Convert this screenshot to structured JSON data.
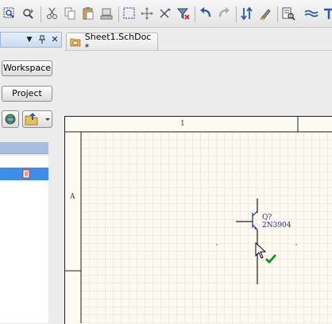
{
  "toolbar": {
    "icons": [
      "zoom-fit-icon",
      "zoom-area-icon",
      "cut-icon",
      "copy-icon",
      "paste-icon",
      "rubber-stamp-icon",
      "select-area-icon",
      "move-icon",
      "cross-select-icon",
      "clear-filter-icon",
      "undo-icon",
      "redo-icon",
      "net-color-icon",
      "highlight-icon",
      "inspector-icon",
      "bus-icon",
      "parameter-icon"
    ]
  },
  "panel": {
    "menu_glyph": "▼",
    "pin_glyph": "📌",
    "close_glyph": "✕",
    "workspace_label": "Workspace",
    "project_label": "Project"
  },
  "tab": {
    "title": "Sheet1.SchDoc *"
  },
  "sheet": {
    "column_zone": "1",
    "row_zone": "A"
  },
  "component": {
    "designator": "Q?",
    "part": "2N3904"
  },
  "colors": {
    "accent_selection": "#3d8ee6",
    "component_blue": "#1c2f8c",
    "sheet_background": "#fcfaf2"
  }
}
